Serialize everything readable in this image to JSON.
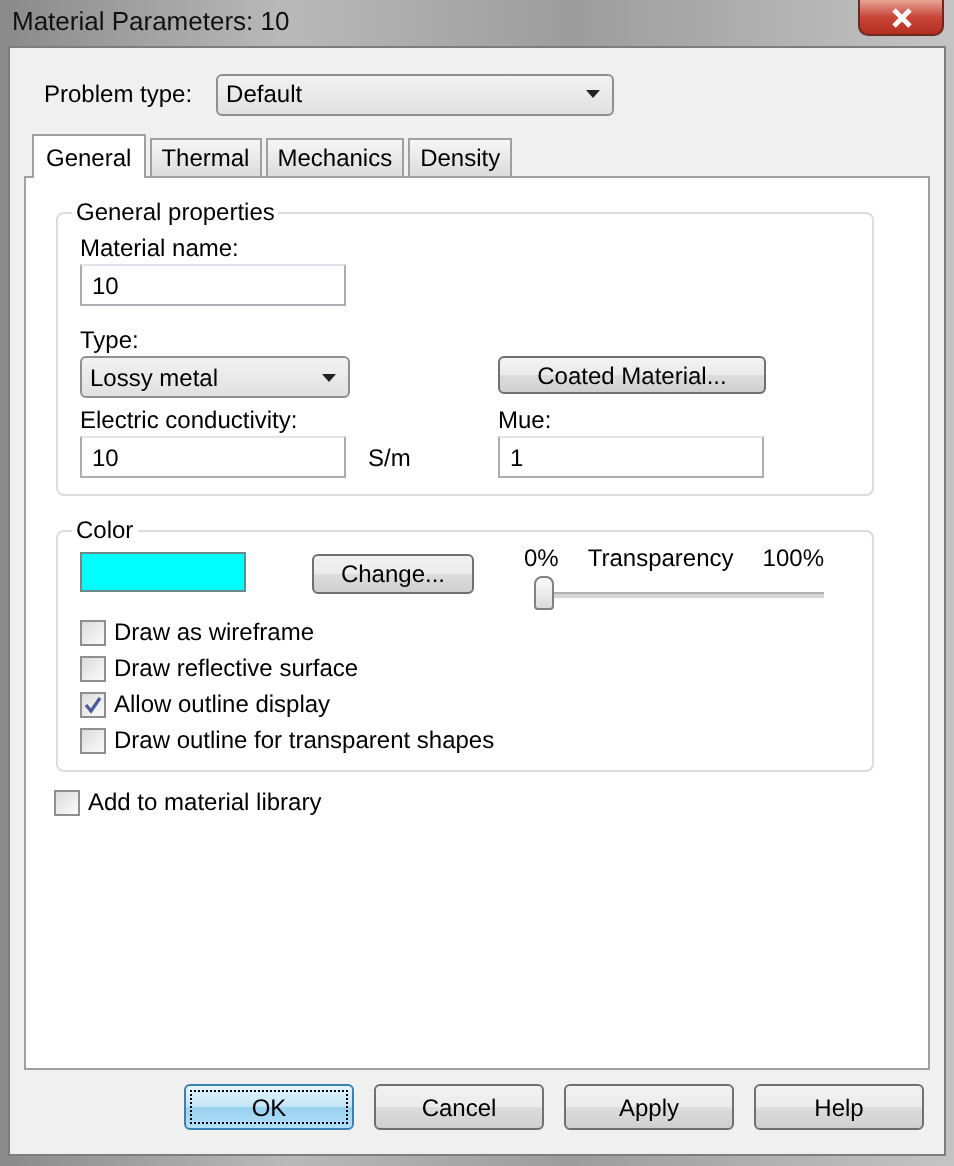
{
  "window": {
    "title": "Material Parameters: 10"
  },
  "problem_type": {
    "label": "Problem type:",
    "value": "Default"
  },
  "tabs": [
    {
      "label": "General",
      "selected": true
    },
    {
      "label": "Thermal",
      "selected": false
    },
    {
      "label": "Mechanics",
      "selected": false
    },
    {
      "label": "Density",
      "selected": false
    }
  ],
  "general_properties": {
    "title": "General properties",
    "material_name": {
      "label": "Material name:",
      "value": "10"
    },
    "type": {
      "label": "Type:",
      "value": "Lossy metal"
    },
    "coated_button": "Coated Material...",
    "conductivity": {
      "label": "Electric conductivity:",
      "value": "10",
      "unit": "S/m"
    },
    "mue": {
      "label": "Mue:",
      "value": "1"
    }
  },
  "color": {
    "title": "Color",
    "swatch": {
      "color": "#00ffff"
    },
    "change_button": "Change...",
    "transparency": {
      "label": "Transparency",
      "min_label": "0%",
      "max_label": "100%",
      "level": 0
    },
    "options": [
      {
        "label": "Draw as wireframe",
        "checked": false
      },
      {
        "label": "Draw reflective surface",
        "checked": false
      },
      {
        "label": "Allow outline display",
        "checked": true
      },
      {
        "label": "Draw outline for transparent shapes",
        "checked": false
      }
    ]
  },
  "add_to_library": {
    "label": "Add to material library",
    "checked": false
  },
  "buttons": [
    {
      "label": "OK",
      "default": true
    },
    {
      "label": "Cancel",
      "default": false
    },
    {
      "label": "Apply",
      "default": false
    },
    {
      "label": "Help",
      "default": false
    }
  ]
}
